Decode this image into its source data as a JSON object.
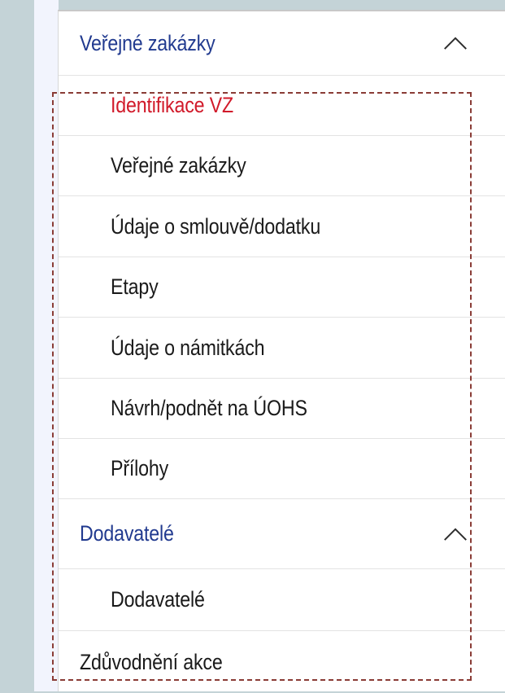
{
  "menu": {
    "sections": [
      {
        "title": "Veřejné zakázky",
        "expanded": true,
        "items": [
          {
            "label": "Identifikace VZ",
            "active": true
          },
          {
            "label": "Veřejné zakázky",
            "active": false
          },
          {
            "label": "Údaje o smlouvě/dodatku",
            "active": false
          },
          {
            "label": "Etapy",
            "active": false
          },
          {
            "label": "Údaje o námitkách",
            "active": false
          },
          {
            "label": "Návrh/podnět na ÚOHS",
            "active": false
          },
          {
            "label": "Přílohy",
            "active": false
          }
        ]
      },
      {
        "title": "Dodavatelé",
        "expanded": true,
        "items": [
          {
            "label": "Dodavatelé",
            "active": false
          }
        ]
      }
    ],
    "bottom_item": {
      "label": "Zdůvodnění akce"
    }
  },
  "icons": {
    "collapse": "chevron-up-icon"
  },
  "colors": {
    "section_title": "#213a8f",
    "active_item": "#d11a2a",
    "item_text": "#1a1a1a",
    "highlight_box": "#8a3c36"
  }
}
